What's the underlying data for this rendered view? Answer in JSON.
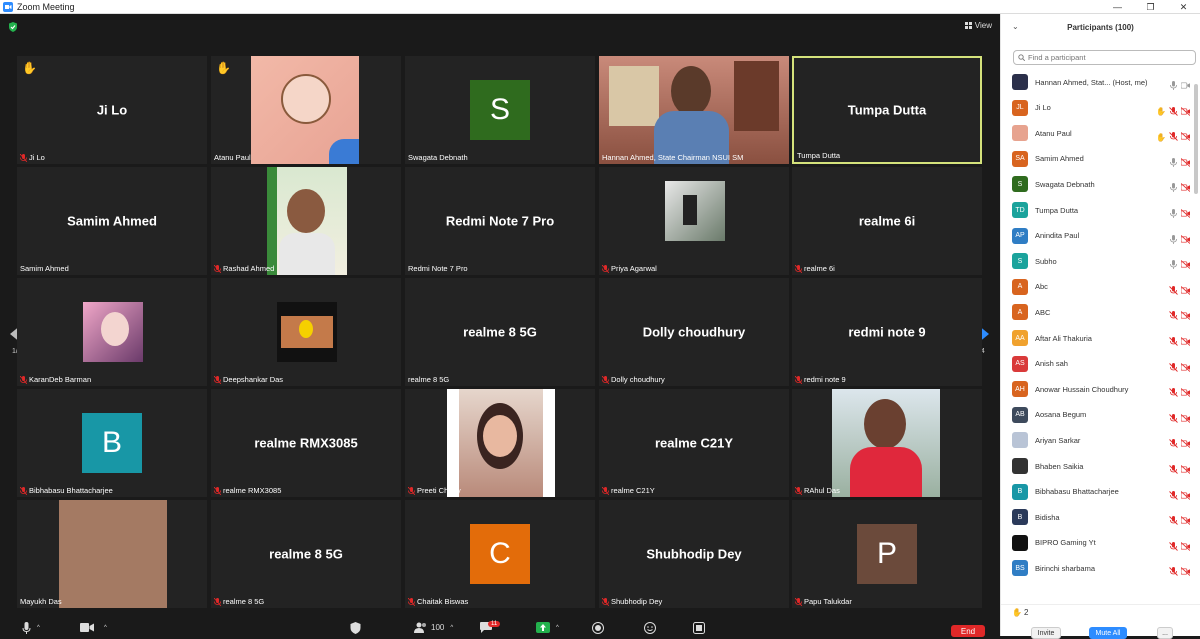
{
  "window": {
    "title": "Zoom Meeting"
  },
  "view_label": "View",
  "page_indicator": {
    "left": "1/4",
    "right": "1/4"
  },
  "tiles": [
    {
      "id": "t1",
      "label": "Ji Lo",
      "center": "Ji Lo",
      "muted": true,
      "hand": true
    },
    {
      "id": "t2",
      "label": "Atanu Paul",
      "center": "",
      "muted": false,
      "hand": true
    },
    {
      "id": "t3",
      "label": "Swagata Debnath",
      "center": "",
      "muted": false,
      "avatar_letter": "S",
      "avatar_color": "#2f6b1e"
    },
    {
      "id": "t4",
      "label": "Hannan Ahmed, State Chairman NSUI SM",
      "center": "",
      "muted": false
    },
    {
      "id": "t5",
      "label": "Tumpa Dutta",
      "center": "Tumpa Dutta",
      "muted": false,
      "active": true
    },
    {
      "id": "t6",
      "label": "Samim Ahmed",
      "center": "Samim Ahmed",
      "muted": false
    },
    {
      "id": "t7",
      "label": "Rashad Ahmed",
      "center": "",
      "muted": true
    },
    {
      "id": "t8",
      "label": "Redmi Note 7 Pro",
      "center": "Redmi Note 7 Pro",
      "muted": false
    },
    {
      "id": "t9",
      "label": "Priya Agarwal",
      "center": "",
      "muted": true
    },
    {
      "id": "t10",
      "label": "realme 6i",
      "center": "realme 6i",
      "muted": true
    },
    {
      "id": "t11",
      "label": "KaranDeb Barman",
      "center": "",
      "muted": true
    },
    {
      "id": "t12",
      "label": "Deepshankar Das",
      "center": "",
      "muted": true
    },
    {
      "id": "t13",
      "label": "realme 8 5G",
      "center": "realme 8 5G",
      "muted": false
    },
    {
      "id": "t14",
      "label": "Dolly choudhury",
      "center": "Dolly choudhury",
      "muted": true
    },
    {
      "id": "t15",
      "label": "redmi note 9",
      "center": "redmi note 9",
      "muted": true
    },
    {
      "id": "t16",
      "label": "Bibhabasu Bhattacharjee",
      "center": "",
      "muted": true,
      "avatar_letter": "B",
      "avatar_color": "#1897a6"
    },
    {
      "id": "t17",
      "label": "realme RMX3085",
      "center": "realme RMX3085",
      "muted": true
    },
    {
      "id": "t18",
      "label": "Preeti Chetry",
      "center": "",
      "muted": true
    },
    {
      "id": "t19",
      "label": "realme C21Y",
      "center": "realme C21Y",
      "muted": true
    },
    {
      "id": "t20",
      "label": "RAhul Das",
      "center": "",
      "muted": true
    },
    {
      "id": "t21",
      "label": "Mayukh Das",
      "center": "",
      "muted": false
    },
    {
      "id": "t22",
      "label": "realme 8 5G",
      "center": "realme 8 5G",
      "muted": true
    },
    {
      "id": "t23",
      "label": "Chaitak Biswas",
      "center": "",
      "muted": true,
      "avatar_letter": "C",
      "avatar_color": "#e36c0a"
    },
    {
      "id": "t24",
      "label": "Shubhodip Dey",
      "center": "Shubhodip Dey",
      "muted": true
    },
    {
      "id": "t25",
      "label": "Papu Talukdar",
      "center": "",
      "muted": true,
      "avatar_letter": "P",
      "avatar_color": "#6b4a3b"
    }
  ],
  "toolbar": {
    "participants_count": "100",
    "chat_badge": "11",
    "end_label": "End"
  },
  "participants_panel": {
    "title": "Participants (100)",
    "search_placeholder": "Find a participant",
    "raised_hands": "2",
    "invite_label": "Invite",
    "mute_all_label": "Mute All",
    "more_label": "...",
    "list": [
      {
        "name": "Hannan Ahmed, Stat... (Host, me)",
        "initials": "",
        "color": "#2b2f4a",
        "mic": "on",
        "video": "on"
      },
      {
        "name": "Ji Lo",
        "initials": "JL",
        "color": "#d8641f",
        "mic": "hand",
        "video": "off"
      },
      {
        "name": "Atanu Paul",
        "initials": "",
        "color": "#e7a38f",
        "mic": "hand",
        "video": "off"
      },
      {
        "name": "Samim Ahmed",
        "initials": "SA",
        "color": "#d8641f",
        "mic": "on",
        "video": "off"
      },
      {
        "name": "Swagata Debnath",
        "initials": "S",
        "color": "#2f6b1e",
        "mic": "on",
        "video": "off"
      },
      {
        "name": "Tumpa Dutta",
        "initials": "TD",
        "color": "#1ba39c",
        "mic": "on",
        "video": "off"
      },
      {
        "name": "Anindita Paul",
        "initials": "AP",
        "color": "#2f7dc4",
        "mic": "on",
        "video": "off"
      },
      {
        "name": "Subho",
        "initials": "S",
        "color": "#1ba39c",
        "mic": "on",
        "video": "off"
      },
      {
        "name": "Abc",
        "initials": "A",
        "color": "#d8641f",
        "mic": "off",
        "video": "off"
      },
      {
        "name": "ABC",
        "initials": "A",
        "color": "#d8641f",
        "mic": "off",
        "video": "off"
      },
      {
        "name": "Aftar Ali Thakuria",
        "initials": "AA",
        "color": "#f0a22e",
        "mic": "off",
        "video": "off"
      },
      {
        "name": "Anish sah",
        "initials": "AS",
        "color": "#d93a3a",
        "mic": "off",
        "video": "off"
      },
      {
        "name": "Anowar Hussain Choudhury",
        "initials": "AH",
        "color": "#d8641f",
        "mic": "off",
        "video": "off"
      },
      {
        "name": "Aosana Begum",
        "initials": "AB",
        "color": "#3d4a5c",
        "mic": "off",
        "video": "off"
      },
      {
        "name": "Ariyan Sarkar",
        "initials": "",
        "color": "#b9c4d6",
        "mic": "off",
        "video": "off"
      },
      {
        "name": "Bhaben Saikia",
        "initials": "",
        "color": "#333333",
        "mic": "off",
        "video": "off"
      },
      {
        "name": "Bibhabasu Bhattacharjee",
        "initials": "B",
        "color": "#1897a6",
        "mic": "off",
        "video": "off"
      },
      {
        "name": "Bidisha",
        "initials": "B",
        "color": "#2b3a5a",
        "mic": "off",
        "video": "off"
      },
      {
        "name": "BIPRO Gaming Yt",
        "initials": "",
        "color": "#111111",
        "mic": "off",
        "video": "off"
      },
      {
        "name": "Birinchi sharbama",
        "initials": "BS",
        "color": "#2f7dc4",
        "mic": "off",
        "video": "off"
      }
    ]
  },
  "colors": {
    "accent_blue": "#2d8cff",
    "end_red": "#e02828",
    "active_border": "#d4e27b"
  }
}
